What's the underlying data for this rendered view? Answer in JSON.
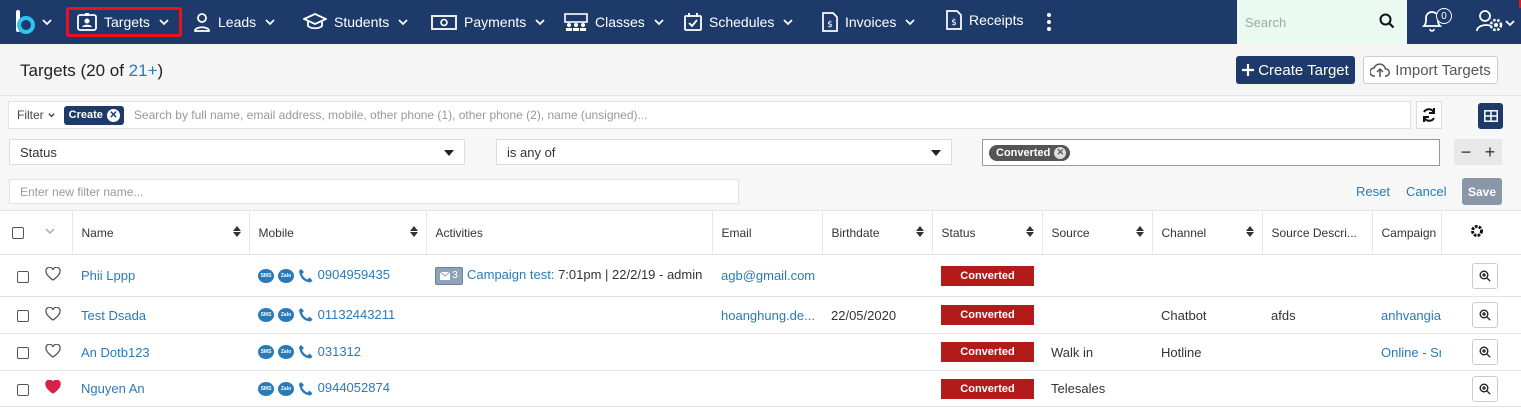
{
  "nav": {
    "items": [
      {
        "id": "targets",
        "label": "Targets",
        "icon": "contact-card-icon",
        "has_chevron": true,
        "active": true
      },
      {
        "id": "leads",
        "label": "Leads",
        "icon": "person-icon",
        "has_chevron": true
      },
      {
        "id": "students",
        "label": "Students",
        "icon": "graduation-cap-icon",
        "has_chevron": true
      },
      {
        "id": "payments",
        "label": "Payments",
        "icon": "money-bill-icon",
        "has_chevron": true
      },
      {
        "id": "classes",
        "label": "Classes",
        "icon": "group-icon",
        "has_chevron": true
      },
      {
        "id": "schedules",
        "label": "Schedules",
        "icon": "calendar-check-icon",
        "has_chevron": true
      },
      {
        "id": "invoices",
        "label": "Invoices",
        "icon": "invoice-icon",
        "has_chevron": true
      },
      {
        "id": "receipts",
        "label": "Receipts",
        "icon": "receipt-icon",
        "has_chevron": false
      }
    ],
    "search_placeholder": "Search",
    "notification_count": "0",
    "accent_color": "#1e3a6b",
    "highlight_color": "#e8141c"
  },
  "header": {
    "title_prefix": "Targets (20 of ",
    "title_count": "21+",
    "title_suffix": ")",
    "create_label": "Create Target",
    "import_label": "Import Targets"
  },
  "filter": {
    "dropdown_label": "Filter",
    "tag_label": "Create",
    "search_placeholder": "Search by full name, email address, mobile, other phone (1), other phone (2), name (unsigned)...",
    "field": "Status",
    "operator": "is any of",
    "value_tag": "Converted",
    "name_placeholder": "Enter new filter name...",
    "reset_label": "Reset",
    "cancel_label": "Cancel",
    "save_label": "Save"
  },
  "table": {
    "columns": {
      "name": "Name",
      "mobile": "Mobile",
      "activities": "Activities",
      "email": "Email",
      "birthdate": "Birthdate",
      "status": "Status",
      "source": "Source",
      "channel": "Channel",
      "source_desc": "Source Descri...",
      "campaign": "Campaign"
    },
    "rows": [
      {
        "name": "Phii Lppp",
        "mobile": "0904959435",
        "activity_count": "3",
        "activity_link": "Campaign test:",
        "activity_text": "7:01pm | 22/2/19 - admin",
        "email": "agb@gmail.com",
        "birthdate": "",
        "status": "Converted",
        "source": "",
        "channel": "",
        "source_desc": "",
        "campaign": "",
        "favorite": false
      },
      {
        "name": "Test Dsada",
        "mobile": "01132443211",
        "activity_count": "",
        "activity_link": "",
        "activity_text": "",
        "email": "hoanghung.de...",
        "birthdate": "22/05/2020",
        "status": "Converted",
        "source": "",
        "channel": "Chatbot",
        "source_desc": "afds",
        "campaign": "anhvangiac",
        "favorite": false
      },
      {
        "name": "An Dotb123",
        "mobile": "031312",
        "activity_count": "",
        "activity_link": "",
        "activity_text": "",
        "email": "",
        "birthdate": "",
        "status": "Converted",
        "source": "Walk in",
        "channel": "Hotline",
        "source_desc": "",
        "campaign": "Online - Sr",
        "favorite": false
      },
      {
        "name": "Nguyen An",
        "mobile": "0944052874",
        "activity_count": "",
        "activity_link": "",
        "activity_text": "",
        "email": "",
        "birthdate": "",
        "status": "Converted",
        "source": "Telesales",
        "channel": "",
        "source_desc": "",
        "campaign": "",
        "favorite": true
      }
    ],
    "sms_label": "SMS",
    "zalo_label": "Zalo",
    "status_color": "#b31b1b",
    "link_color": "#2a7ab8"
  }
}
